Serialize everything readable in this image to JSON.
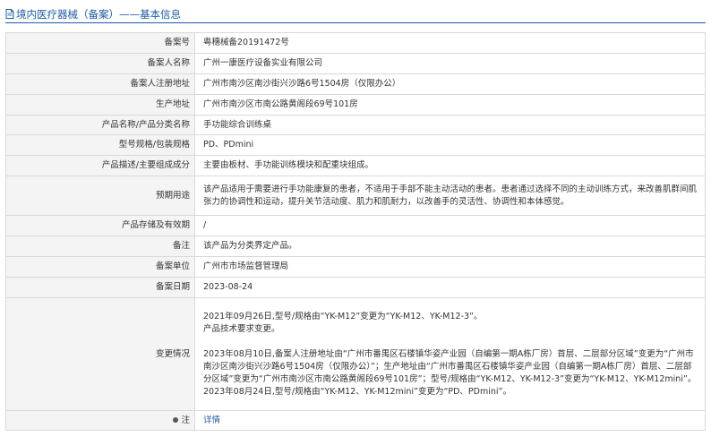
{
  "header": {
    "title": "境内医疗器械（备案）——基本信息"
  },
  "fields": [
    {
      "label": "备案号",
      "value": "粤穗械备20191472号"
    },
    {
      "label": "备案人名称",
      "value": "广州一康医疗设备实业有限公司"
    },
    {
      "label": "备案人注册地址",
      "value": "广州市南沙区南沙街兴沙路6号1504房（仅限办公）"
    },
    {
      "label": "生产地址",
      "value": "广州市南沙区市南公路黄阁段69号101房"
    },
    {
      "label": "产品名称/产品分类名称",
      "value": "手功能综合训练桌"
    },
    {
      "label": "型号规格/包装规格",
      "value": "PD、PDmini"
    },
    {
      "label": "产品描述/主要组成成分",
      "value": "主要由板材、手功能训练模块和配重块组成。"
    },
    {
      "label": "预期用途",
      "value": "该产品适用于需要进行手功能康复的患者，不适用于手部不能主动活动的患者。患者通过选择不同的主动训练方式，来改善肌群间肌张力的协调性和运动，提升关节活动度、肌力和肌耐力，以改善手的灵活性、协调性和本体感觉。"
    },
    {
      "label": "产品存储及有效期",
      "value": "/"
    },
    {
      "label": "备注",
      "value": "该产品为分类界定产品。"
    },
    {
      "label": "备案单位",
      "value": "广州市市场监督管理局"
    },
    {
      "label": "备案日期",
      "value": "2023-08-24"
    }
  ],
  "changes": {
    "label": "变更情况",
    "entry1": "2021年09月26日,型号/规格由“YK-M12”变更为“YK-M12、YK-M12-3”。",
    "entry1_note": "产品技术要求变更。",
    "entry2": "2023年08月10日,备案人注册地址由“广州市番禺区石楼镇华姿产业园（自编第一期A栋厂房）首层、二层部分区域”变更为“广州市南沙区南沙街兴沙路6号1504房（仅限办公）”；生产地址由“广州市番禺区石楼镇华姿产业园（自编第一期A栋厂房）首层、二层部分区域”变更为“广州市南沙区市南公路黄阁段69号101房”；型号/规格由“YK-M12、YK-M12-3”变更为“YK-M12、YK-M12mini”。",
    "entry3": "2023年08月24日,型号/规格由“YK-M12、YK-M12mini”变更为“PD、PDmini”。"
  },
  "note_row": {
    "label": "注",
    "link_text": "详情"
  }
}
